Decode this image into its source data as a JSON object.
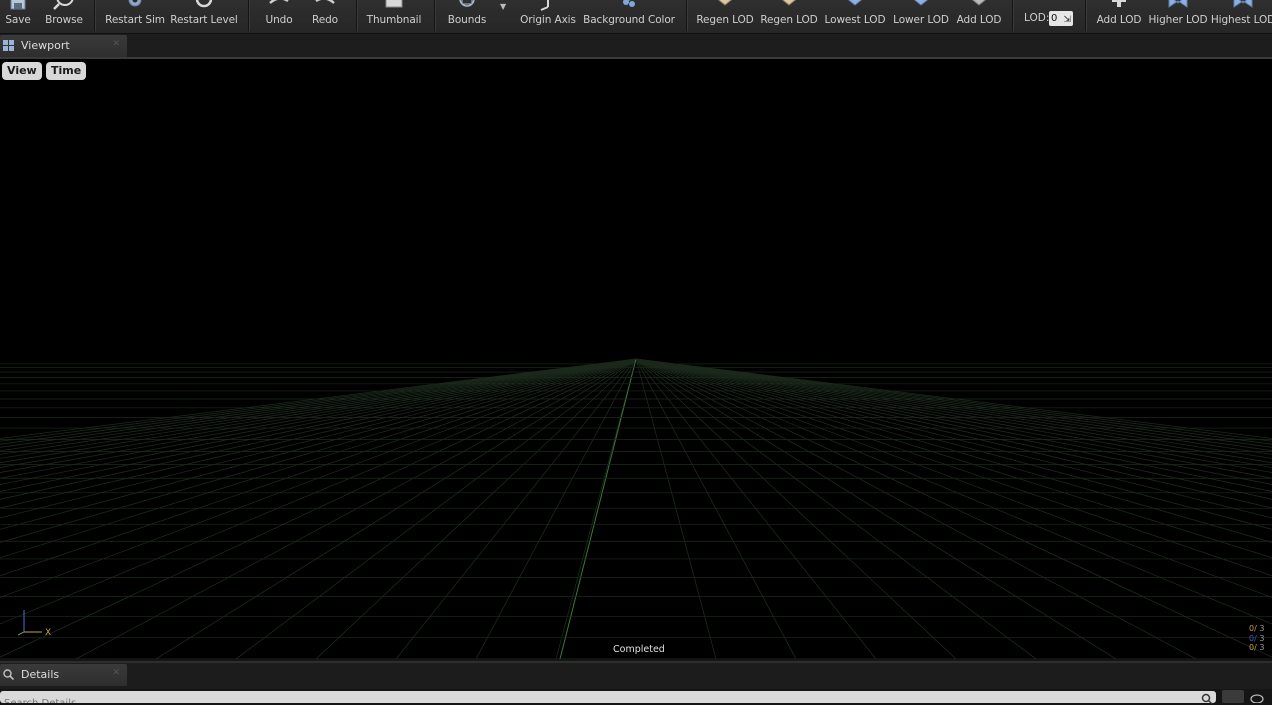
{
  "toolbar": {
    "buttons": [
      {
        "label": "Save",
        "icon": "save-icon"
      },
      {
        "label": "Browse",
        "icon": "browse-icon"
      },
      {
        "label": "Restart Sim",
        "icon": "restart-sim-icon"
      },
      {
        "label": "Restart Level",
        "icon": "restart-level-icon"
      },
      {
        "label": "Undo",
        "icon": "undo-icon"
      },
      {
        "label": "Redo",
        "icon": "redo-icon"
      },
      {
        "label": "Thumbnail",
        "icon": "thumbnail-icon"
      },
      {
        "label": "Bounds",
        "icon": "bounds-icon"
      },
      {
        "label": "Origin Axis",
        "icon": "origin-axis-icon"
      },
      {
        "label": "Background Color",
        "icon": "background-color-icon"
      },
      {
        "label": "Regen LOD",
        "icon": "regen-lod-icon"
      },
      {
        "label": "Regen LOD",
        "icon": "regen-lod-icon"
      },
      {
        "label": "Lowest LOD",
        "icon": "lowest-lod-icon"
      },
      {
        "label": "Lower LOD",
        "icon": "lower-lod-icon"
      },
      {
        "label": "Add LOD",
        "icon": "add-lod-icon"
      },
      {
        "label": "Add LOD",
        "icon": "add-lod-icon"
      },
      {
        "label": "Higher LOD",
        "icon": "higher-lod-icon"
      },
      {
        "label": "Highest LOD",
        "icon": "highest-lod-icon"
      }
    ],
    "lod_label": "LOD:",
    "lod_value": "0"
  },
  "viewport_tab": {
    "label": "Viewport"
  },
  "viewport": {
    "view_button": "View",
    "time_button": "Time",
    "status": "Completed",
    "axis_label": "X",
    "stats": [
      "0/",
      "0/",
      "0/"
    ],
    "stats_tail": [
      "3",
      "3",
      "3"
    ]
  },
  "details_tab": {
    "label": "Details"
  },
  "details": {
    "search_placeholder": "Search Details"
  },
  "colors": {
    "toolbar_bg": "#2a2a2a",
    "viewport_bg": "#000000",
    "grid": "#1c2a1c",
    "grid_axis": "#3a7a3a",
    "tab_bg": "#333333"
  }
}
